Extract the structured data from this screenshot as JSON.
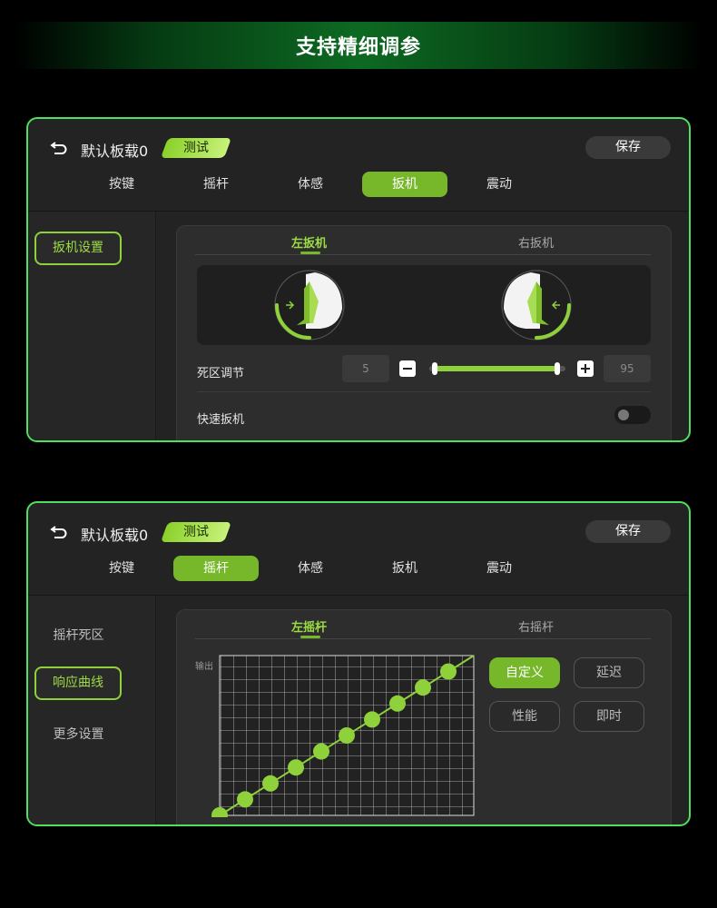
{
  "banner": {
    "title": "支持精细调参"
  },
  "screens": [
    {
      "profile_name": "默认板载0",
      "test_label": "测试",
      "save_label": "保存",
      "tabs": [
        "按键",
        "摇杆",
        "体感",
        "扳机",
        "震动"
      ],
      "active_tab": "扳机",
      "sidebar": [
        "扳机设置"
      ],
      "sub_tabs": [
        "左扳机",
        "右扳机"
      ],
      "deadzone": {
        "label": "死区调节",
        "min_value": "5",
        "max_value": "95"
      },
      "quick_trigger": {
        "label": "快速扳机",
        "enabled": false
      }
    },
    {
      "profile_name": "默认板载0",
      "test_label": "测试",
      "save_label": "保存",
      "tabs": [
        "按键",
        "摇杆",
        "体感",
        "扳机",
        "震动"
      ],
      "active_tab": "摇杆",
      "sidebar": [
        "摇杆死区",
        "响应曲线",
        "更多设置"
      ],
      "active_sidebar": "响应曲线",
      "sub_tabs": [
        "左摇杆",
        "右摇杆"
      ],
      "curve_axis_label": "输出",
      "curve_modes": [
        "自定义",
        "延迟",
        "性能",
        "即时"
      ],
      "active_mode": "自定义"
    }
  ],
  "colors": {
    "accent": "#76b82a",
    "border": "#4ee05e",
    "panel": "#2d2d2d"
  }
}
